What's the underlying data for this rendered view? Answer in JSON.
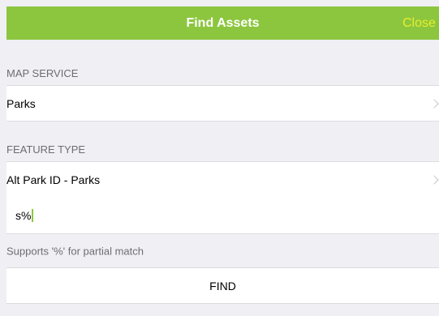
{
  "navbar": {
    "title": "Find Assets",
    "close_label": "Close"
  },
  "map_service": {
    "header": "MAP SERVICE",
    "value": "Parks",
    "disclosure_icon": "chevron-right-icon"
  },
  "feature_type": {
    "header": "FEATURE TYPE",
    "value": "Alt Park ID - Parks",
    "disclosure_icon": "chevron-right-icon"
  },
  "search": {
    "value": "s%",
    "hint": "Supports '%' for partial match"
  },
  "find_button": {
    "label": "FIND"
  },
  "colors": {
    "accent": "#8cc63f",
    "close_text": "#e6ef2a",
    "background": "#efeff4",
    "cell": "#ffffff",
    "secondary_text": "#6d6d72"
  }
}
